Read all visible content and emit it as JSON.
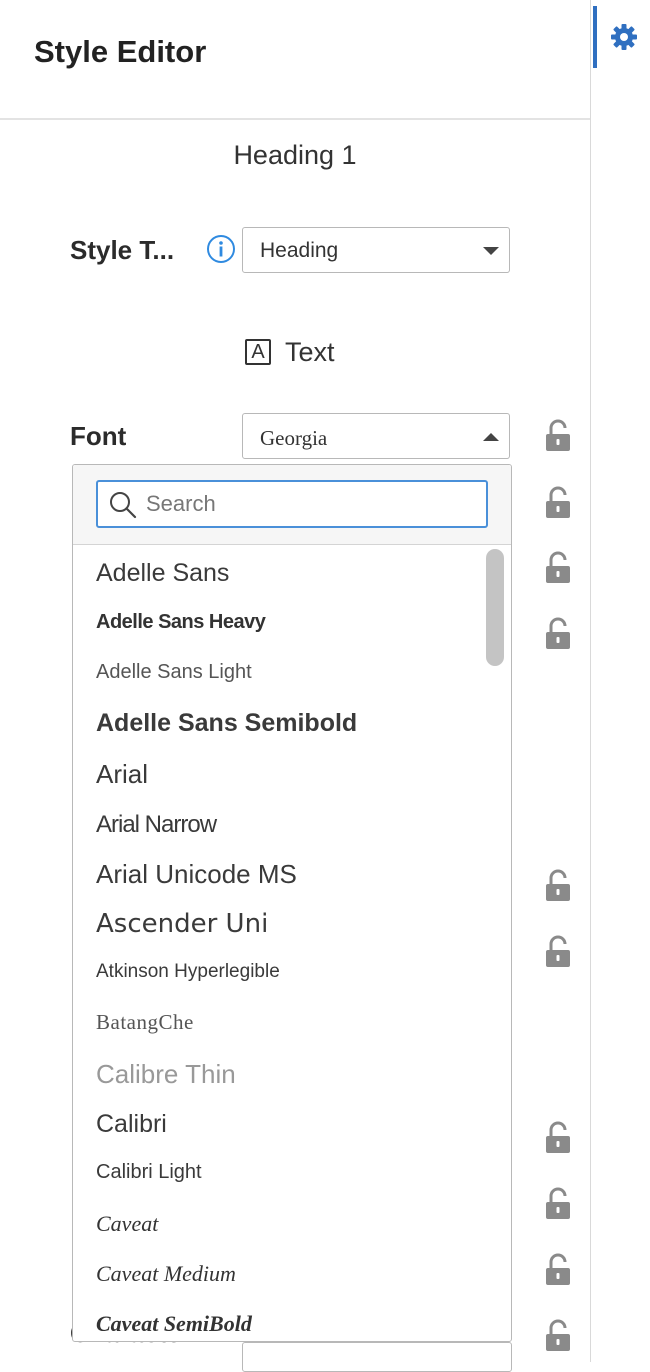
{
  "header": {
    "title": "Style Editor"
  },
  "style": {
    "name": "Heading 1",
    "style_type_label": "Style T...",
    "style_type_value": "Heading"
  },
  "section": {
    "text_label": "Text",
    "text_icon_glyph": "A"
  },
  "font": {
    "label": "Font",
    "value": "Georgia",
    "search_placeholder": "Search",
    "options": [
      "Adelle Sans",
      "Adelle Sans Heavy",
      "Adelle Sans Light",
      "Adelle Sans Semibold",
      "Arial",
      "Arial Narrow",
      "Arial Unicode MS",
      "Ascender Uni",
      "Atkinson Hyperlegible",
      "BatangChe",
      "Calibre Thin",
      "Calibri",
      "Calibri Light",
      "Caveat",
      "Caveat Medium",
      "Caveat SemiBold"
    ]
  },
  "hidden_row": {
    "label": "Character ..."
  },
  "icons": {
    "settings": "gear-icon",
    "info": "info-icon",
    "lock": "lock-icon",
    "search": "search-icon"
  },
  "colors": {
    "accent": "#2f6fc0",
    "focus": "#4a90d9",
    "lock": "#8a8a8a"
  }
}
